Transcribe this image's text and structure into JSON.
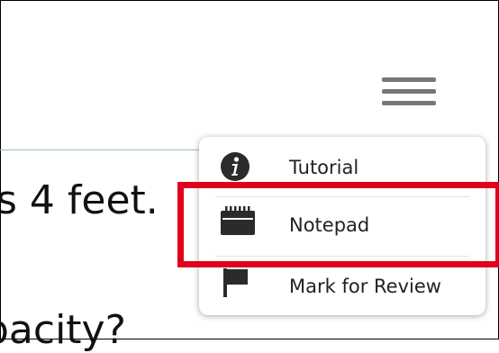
{
  "content": {
    "line1": "s 4 feet.",
    "line2": "pacity?"
  },
  "header": {
    "menu_icon": "hamburger-menu-icon"
  },
  "menu": {
    "items": [
      {
        "label": "Tutorial",
        "icon": "info-icon"
      },
      {
        "label": "Notepad",
        "icon": "notepad-icon"
      },
      {
        "label": "Mark for Review",
        "icon": "flag-icon"
      }
    ]
  },
  "colors": {
    "highlight": "#e0001b",
    "icon": "#2b2b2b",
    "hamburger": "#777777",
    "rule": "#8fbcc9"
  }
}
